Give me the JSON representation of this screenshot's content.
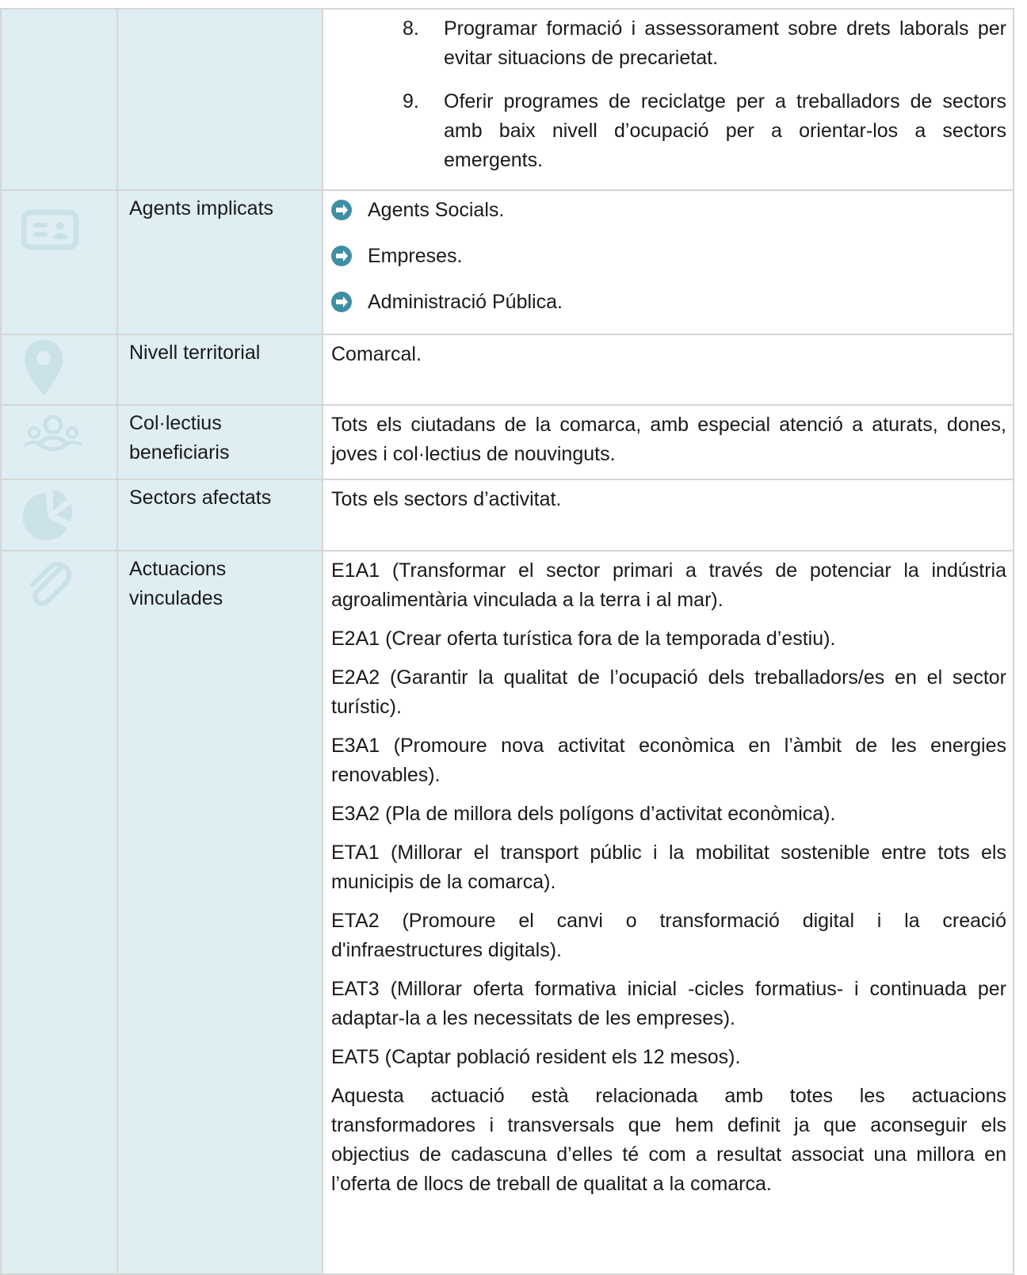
{
  "continuation_steps": [
    {
      "num": "8.",
      "text": "Programar formació i assessorament sobre drets laborals per evitar situacions de precarietat."
    },
    {
      "num": "9.",
      "text": "Oferir programes de reciclatge per a treballadors de sectors amb baix nivell d’ocupació per a orientar-los a sectors emergents."
    }
  ],
  "rows": {
    "agents": {
      "icon": "id-card-icon",
      "label": "Agents implicats",
      "items": [
        "Agents Socials.",
        "Empreses.",
        "Administració Pública."
      ]
    },
    "territorial": {
      "icon": "map-pin-icon",
      "label": "Nivell territorial",
      "text": "Comarcal."
    },
    "beneficiaries": {
      "icon": "people-group-icon",
      "label": "Col·lectius beneficiaris",
      "text": "Tots els ciutadans de la comarca, amb especial atenció a aturats, dones, joves i col·lectius de nouvinguts."
    },
    "sectors": {
      "icon": "pie-chart-icon",
      "label": "Sectors afectats",
      "text": "Tots els sectors d’activitat."
    },
    "linked": {
      "icon": "paperclip-icon",
      "label": "Actuacions vinculades",
      "items": [
        "E1A1 (Transformar el sector primari a través de potenciar la indústria agroalimentària vinculada a la terra i al mar).",
        "E2A1 (Crear oferta turística fora de la temporada d’estiu).",
        "E2A2 (Garantir la qualitat de l’ocupació dels treballadors/es en el sector turístic).",
        "E3A1 (Promoure nova activitat econòmica en l’àmbit de les energies renovables).",
        "E3A2 (Pla de millora dels polígons d’activitat econòmica).",
        "ETA1 (Millorar el transport públic i la mobilitat sostenible entre tots els municipis de la comarca).",
        "ETA2 (Promoure el canvi o transformació digital i la creació d'infraestructures digitals).",
        "EAT3 (Millorar oferta formativa inicial -cicles formatius- i continuada per adaptar-la a les necessitats de les empreses).",
        "EAT5 (Captar població resident els 12 mesos).",
        "Aquesta actuació està relacionada amb totes les actuacions transformadores i transversals que hem definit ja que aconseguir els objectius de cadascuna d’elles té com a resultat associat una millora en l’oferta de llocs de treball de qualitat a la comarca."
      ]
    }
  },
  "colors": {
    "label_column_bg": "#dfeef2",
    "icon_color": "#c9e1e7",
    "arrow_color": "#3f8fa4",
    "border": "#d6d6d6"
  }
}
